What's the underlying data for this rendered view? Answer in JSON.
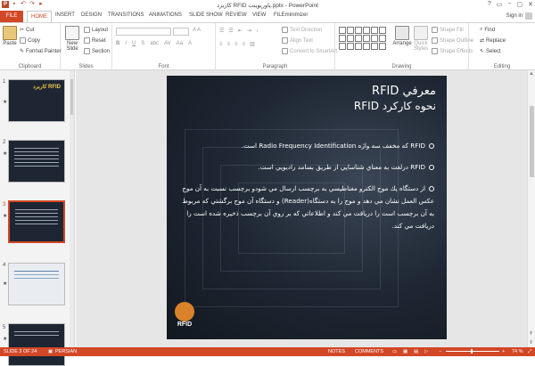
{
  "window": {
    "title": "کاربرد RFID پاورپوینت.pptx - PowerPoint",
    "controls": [
      "?",
      "▭",
      "−",
      "▢",
      "✕"
    ]
  },
  "tabs": [
    "FILE",
    "HOME",
    "INSERT",
    "DESIGN",
    "TRANSITIONS",
    "ANIMATIONS",
    "SLIDE SHOW",
    "REVIEW",
    "VIEW",
    "FILEminimizer"
  ],
  "active_tab": "HOME",
  "account": {
    "signin": "Sign in"
  },
  "ribbon": {
    "clipboard": {
      "label": "Clipboard",
      "paste": "Paste",
      "cut": "Cut",
      "copy": "Copy",
      "format_painter": "Format Painter"
    },
    "slides": {
      "label": "Slides",
      "new_slide": "New Slide",
      "layout": "Layout",
      "reset": "Reset",
      "section": "Section"
    },
    "font": {
      "label": "Font"
    },
    "paragraph": {
      "label": "Paragraph",
      "text_direction": "Text Direction",
      "align_text": "Align Text",
      "smartart": "Convert to SmartArt"
    },
    "drawing": {
      "label": "Drawing",
      "arrange": "Arrange",
      "quick_styles": "Quick Styles",
      "shape_fill": "Shape Fill",
      "shape_outline": "Shape Outline",
      "shape_effects": "Shape Effects"
    },
    "editing": {
      "label": "Editing",
      "find": "Find",
      "replace": "Replace",
      "select": "Select"
    }
  },
  "thumbnails": [
    {
      "num": "1",
      "title": "کاربرد RFID"
    },
    {
      "num": "2",
      "title": ""
    },
    {
      "num": "3",
      "title": ""
    },
    {
      "num": "4",
      "title": ""
    },
    {
      "num": "5",
      "title": ""
    }
  ],
  "slide": {
    "title_line1": "معرفي RFID",
    "title_line2": "نحوه كاركرد RFID",
    "bullets": [
      "RFID که مخفف سه واژه Radio Frequency Identification است.",
      "RFID درلغت به معناي شناسايي از طريق بسامد راديويي است.",
      "از دستگاه يك موج الكترو مغناطيسي به برچسب ارسال مي شودو برچسب نسبت به آن موج عكس العمل نشان مي دهد و موج را به دستگاه(Reader) و دستگاه آن موج برگشتي كه مربوط به آن برچسب است را دريافت مي كند و اطلاعاتي كه بر روي آن برچسب ذخيره شده است را دريافت مي كند."
    ],
    "logo_text": "RFID"
  },
  "status": {
    "slide_pos": "SLIDE 3 OF 24",
    "language": "PERSIAN",
    "notes": "NOTES",
    "comments": "COMMENTS",
    "zoom": "74 %"
  },
  "colors": {
    "accent": "#d24726",
    "slide_bg": "#1e2733",
    "logo": "#d9822b"
  }
}
